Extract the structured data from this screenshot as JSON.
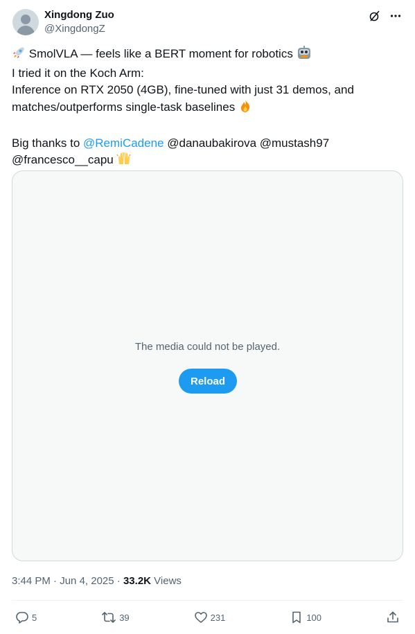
{
  "author": {
    "name": "Xingdong Zuo",
    "handle": "@XingdongZ"
  },
  "header_icons": [
    "grok-icon",
    "more-icon"
  ],
  "tweet": {
    "line1": "SmolVLA — feels like a BERT moment for robotics",
    "line2": "I tried it on the Koch Arm:",
    "line3": "Inference on RTX 2050 (4GB), fine-tuned with just 31 demos, and matches/outperforms single-task baselines",
    "thanks_prefix": "Big thanks to",
    "mention_link": "@RemiCadene",
    "mentions_rest": "@danaubakirova @mustash97 @francesco__capu",
    "emojis": [
      "rocket",
      "robot",
      "fire",
      "raised-hands"
    ]
  },
  "media": {
    "message": "The media could not be played.",
    "reload_label": "Reload"
  },
  "meta": {
    "time": "3:44 PM",
    "sep1": "·",
    "date": "Jun 4, 2025",
    "sep2": "·",
    "views_count": "33.2K",
    "views_label": "Views"
  },
  "actions": {
    "replies": "5",
    "reposts": "39",
    "likes": "231",
    "bookmarks": "100"
  },
  "colors": {
    "link": "#1d9bf0",
    "secondary_text": "#536471",
    "media_bg": "#f7f9f9"
  }
}
